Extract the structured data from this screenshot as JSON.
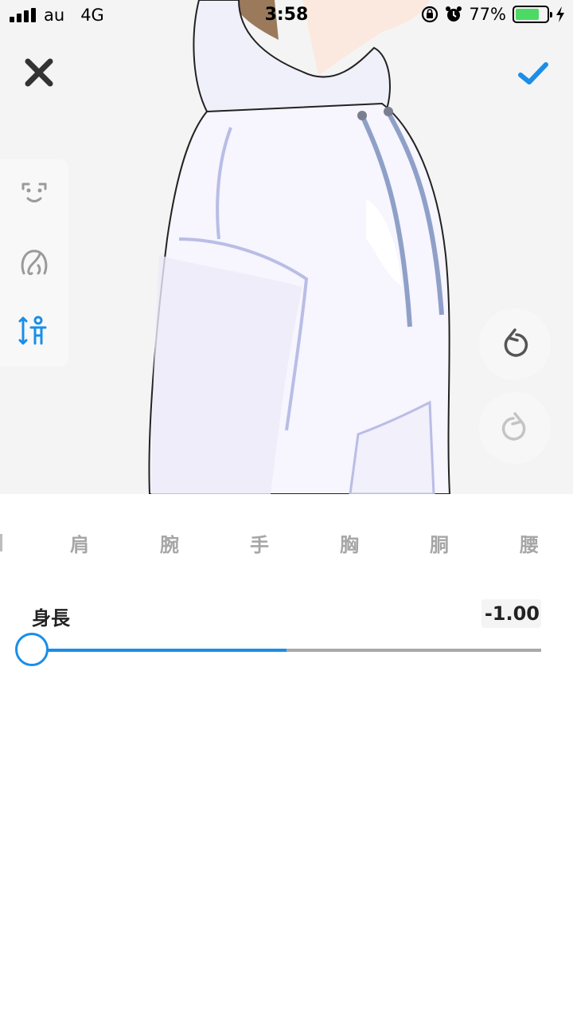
{
  "status_bar": {
    "carrier": "au",
    "network": "4G",
    "time": "3:58",
    "battery_percent_text": "77%",
    "battery_level": 0.77
  },
  "toolbar": {
    "close_icon": "close-icon",
    "confirm_icon": "checkmark-icon",
    "accent_color": "#1a8ee8"
  },
  "categories": [
    {
      "icon": "face-icon",
      "active": false
    },
    {
      "icon": "hair-icon",
      "active": false
    },
    {
      "icon": "body-height-icon",
      "active": true
    }
  ],
  "history": {
    "undo_icon": "undo-icon",
    "redo_icon": "redo-icon"
  },
  "tabs": [
    "肩",
    "腕",
    "手",
    "胸",
    "胴",
    "腰"
  ],
  "parameter": {
    "label": "身長",
    "value_text": "-1.00",
    "value": -1.0,
    "min": -1.0,
    "max": 1.0
  }
}
